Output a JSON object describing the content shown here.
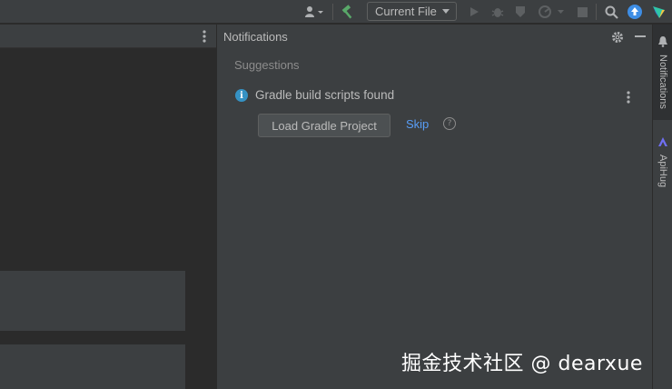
{
  "toolbar": {
    "run_config": "Current File",
    "icons": [
      "user-icon",
      "hammer-icon",
      "run-icon",
      "debug-icon",
      "coverage-icon",
      "profile-icon",
      "stop-icon",
      "search-icon",
      "update-icon",
      "plugin-icon"
    ]
  },
  "notifications": {
    "title": "Notifications",
    "section": "Suggestions",
    "item": {
      "message": "Gradle build scripts found",
      "primary_action": "Load Gradle Project",
      "secondary_action": "Skip",
      "help_glyph": "?"
    }
  },
  "right_stripe": {
    "tabs": [
      {
        "label": "Notifications"
      },
      {
        "label": "ApiHug"
      }
    ]
  },
  "watermark": "掘金技术社区 @ dearxue",
  "colors": {
    "panel_bg": "#3c3f41",
    "editor_bg": "#2b2b2b",
    "accent_link": "#589df6",
    "info_blue": "#3592c4",
    "hammer_green": "#59a869",
    "update_blue": "#3e8ee5"
  }
}
